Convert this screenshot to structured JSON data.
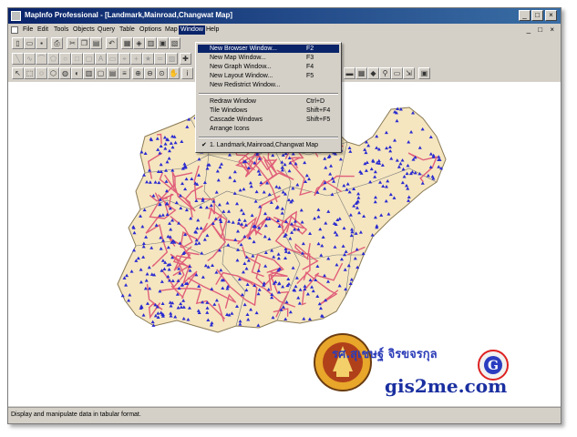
{
  "window": {
    "title": "MapInfo Professional - [Landmark,Mainroad,Changwat Map]",
    "controls": {
      "minimize": "_",
      "maximize": "□",
      "close": "×"
    }
  },
  "menubar": {
    "items": [
      "File",
      "Edit",
      "Tools",
      "Objects",
      "Query",
      "Table",
      "Options",
      "Map",
      "Window",
      "Help"
    ],
    "active": "Window",
    "mdi_controls": "_ □ ×"
  },
  "window_menu": {
    "items": [
      {
        "label": "New Browser Window...",
        "shortcut": "F2",
        "highlighted": true
      },
      {
        "label": "New Map Window...",
        "shortcut": "F3"
      },
      {
        "label": "New Graph Window...",
        "shortcut": "F4"
      },
      {
        "label": "New Layout Window...",
        "shortcut": "F5"
      },
      {
        "label": "New Redistrict Window...",
        "shortcut": ""
      },
      {
        "label": "Redraw Window",
        "shortcut": "Ctrl+D"
      },
      {
        "label": "Tile Windows",
        "shortcut": "Shift+F4"
      },
      {
        "label": "Cascade Windows",
        "shortcut": "Shift+F5"
      },
      {
        "label": "Arrange Icons",
        "shortcut": ""
      },
      {
        "label": "1. Landmark,Mainroad,Changwat Map",
        "shortcut": "",
        "checked": true
      }
    ]
  },
  "toolbars": {
    "standard_icons": [
      "new-icon",
      "open-icon",
      "save-icon",
      "print-icon",
      "cut-icon",
      "copy-icon",
      "paste-icon",
      "undo-icon",
      "new-browser-icon",
      "new-map-icon",
      "new-graph-icon",
      "new-layout-icon",
      "new-redistrict-icon"
    ],
    "drawing_icons": [
      "select-icon",
      "marquee-icon",
      "radius-icon",
      "polygon-select-icon",
      "boundary-icon",
      "invert-icon",
      "zoom-in-icon",
      "zoom-out-icon",
      "change-view-icon",
      "grabber-icon",
      "info-icon",
      "hotlink-icon",
      "label-icon"
    ]
  },
  "status": {
    "text": "Display and manipulate data in tabular format."
  },
  "overlay": {
    "author_text": "รศ.สุเชษฐ์ จิรขจรกุล",
    "site": "gis2me.com",
    "logo_text": "THAMMASAT UNIVERSITY"
  },
  "colors": {
    "title_gradient_start": "#0a246a",
    "title_gradient_end": "#3a6ea5",
    "map_land": "#f5e6c0",
    "roads": "#e0607a",
    "landmarks": "#2a2ad0"
  }
}
